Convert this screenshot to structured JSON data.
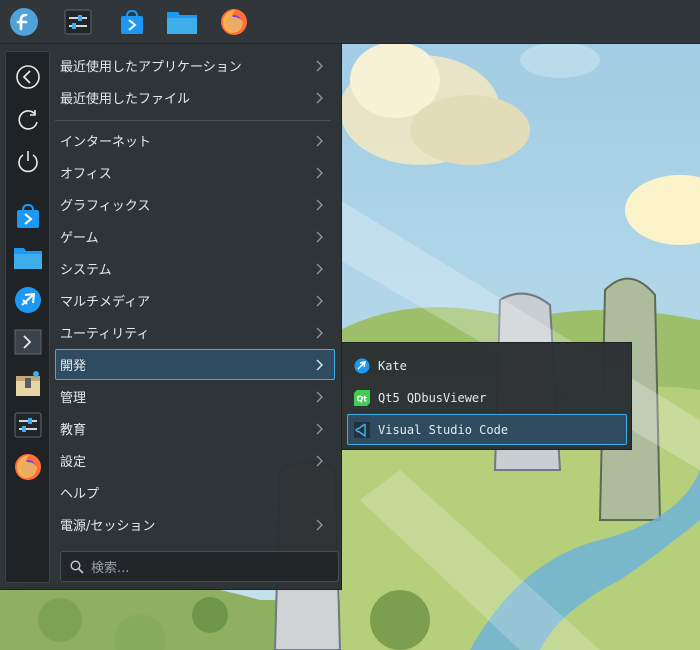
{
  "panel": {
    "launchers": [
      {
        "icon": "fedora-logo-icon"
      },
      {
        "icon": "system-settings-icon"
      },
      {
        "icon": "discover-store-icon"
      },
      {
        "icon": "dolphin-folder-icon"
      },
      {
        "icon": "firefox-icon"
      }
    ]
  },
  "sidebar": {
    "buttons": [
      {
        "icon": "back-arrow-icon"
      },
      {
        "icon": "restart-icon"
      },
      {
        "icon": "power-icon"
      },
      {
        "icon": "discover-store-icon"
      },
      {
        "icon": "folder-icon"
      },
      {
        "icon": "kde-connect-icon"
      },
      {
        "icon": "terminal-icon"
      },
      {
        "icon": "archive-icon"
      },
      {
        "icon": "system-settings-icon"
      },
      {
        "icon": "firefox-icon"
      }
    ]
  },
  "menu": {
    "recent": [
      {
        "label": "最近使用したアプリケーション"
      },
      {
        "label": "最近使用したファイル"
      }
    ],
    "categories": [
      {
        "label": "インターネット"
      },
      {
        "label": "オフィス"
      },
      {
        "label": "グラフィックス"
      },
      {
        "label": "ゲーム"
      },
      {
        "label": "システム"
      },
      {
        "label": "マルチメディア"
      },
      {
        "label": "ユーティリティ"
      },
      {
        "label": "開発"
      },
      {
        "label": "管理"
      },
      {
        "label": "教育"
      },
      {
        "label": "設定"
      },
      {
        "label": "ヘルプ"
      },
      {
        "label": "電源/セッション"
      }
    ],
    "active_category": "開発"
  },
  "search": {
    "placeholder": "検索..."
  },
  "submenu": {
    "items": [
      {
        "label": "Kate",
        "icon": "kate-icon"
      },
      {
        "label": "Qt5 QDbusViewer",
        "icon": "qt-icon"
      },
      {
        "label": "Visual Studio Code",
        "icon": "vscode-icon"
      }
    ],
    "active": "Visual Studio Code"
  },
  "colors": {
    "panel_bg": "#31363b",
    "menu_bg": "#2a2e32",
    "highlight_border": "#3daee9",
    "highlight_bg": "#2f4b5f"
  }
}
